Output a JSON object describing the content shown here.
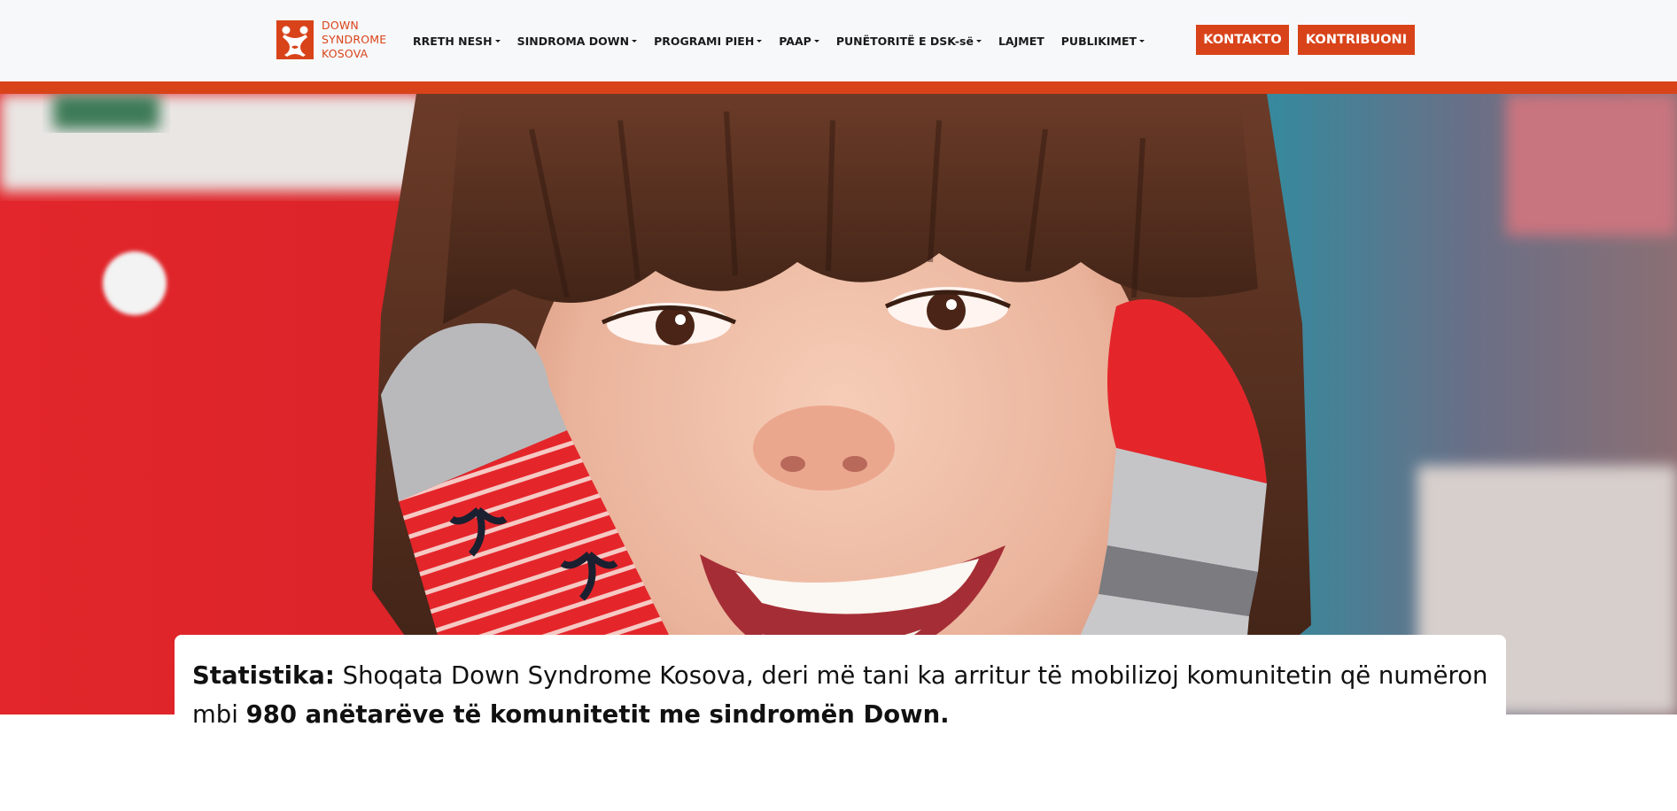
{
  "header": {
    "logo": {
      "lines": [
        "DOWN",
        "SYNDROME",
        "KOSOVA"
      ]
    },
    "nav": [
      {
        "label": "RRETH NESH",
        "has_dropdown": true
      },
      {
        "label": "SINDROMA DOWN",
        "has_dropdown": true
      },
      {
        "label": "PROGRAMI PIEH",
        "has_dropdown": true
      },
      {
        "label": "PAAP",
        "has_dropdown": true
      },
      {
        "label": "PUNËTORITË E DSK-së",
        "has_dropdown": true
      },
      {
        "label": "LAJMET",
        "has_dropdown": false
      },
      {
        "label": "PUBLIKIMET",
        "has_dropdown": true
      }
    ],
    "buttons": {
      "contact": "KONTAKTO",
      "contribute": "KONTRIBUONI"
    }
  },
  "stat": {
    "label": "Statistika:",
    "text_part1": " Shoqata Down Syndrome Kosova, deri më tani ka arritur të mobilizoj komunitetin që numëron mbi ",
    "highlight": "980 anëtarëve të komunitetit me sindromën Down."
  },
  "colors": {
    "brand": "#d9431a",
    "header_bg": "#f7f8fa",
    "text": "#111111"
  }
}
